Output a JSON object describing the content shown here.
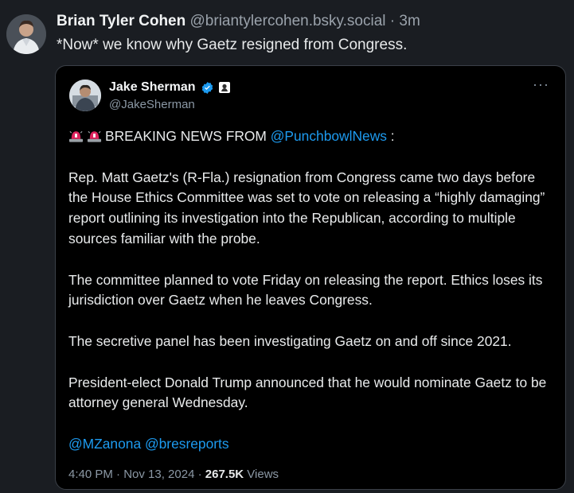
{
  "post": {
    "author_name": "Brian Tyler Cohen",
    "author_handle": "@briantylercohen.bsky.social",
    "separator": "·",
    "time": "3m",
    "text": "*Now* we know why Gaetz resigned from Congress."
  },
  "quote": {
    "author_name": "Jake Sherman",
    "author_handle": "@JakeSherman",
    "more_label": "···",
    "breaking_prefix": "BREAKING NEWS FROM ",
    "breaking_link": "@PunchbowlNews",
    "breaking_suffix": " :",
    "paragraph_1": "Rep. Matt Gaetz's (R-Fla.) resignation from Congress came two days before the House Ethics Committee was set to vote on releasing a “highly damaging” report outlining its investigation into the Republican, according to multiple sources familiar with the probe.",
    "paragraph_2": "The committee planned to vote Friday on releasing the report. Ethics loses its jurisdiction over Gaetz when he leaves Congress.",
    "paragraph_3": "The secretive panel has been investigating Gaetz on and off since 2021.",
    "paragraph_4": "President-elect Donald Trump announced that he would nominate Gaetz to be attorney general Wednesday.",
    "mentions": "@MZanona @bresreports",
    "meta_time": "4:40 PM · Nov 13, 2024 · ",
    "views_count": "267.5K",
    "views_label": " Views"
  },
  "icons": {
    "siren": "police-light-emoji",
    "verified": "verified-badge",
    "affiliate": "affiliate-badge"
  },
  "colors": {
    "background": "#1a1d22",
    "quote_background": "#000000",
    "link": "#1d9bf0",
    "verified": "#1d9bf0",
    "siren": "#e0245e"
  }
}
